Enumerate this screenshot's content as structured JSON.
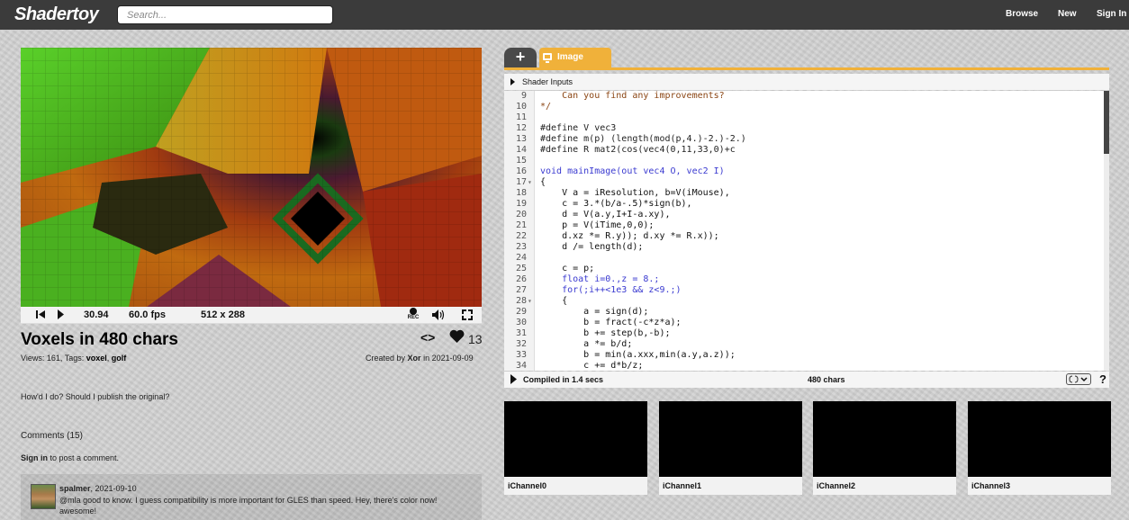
{
  "header": {
    "logo": "Shadertoy",
    "search_placeholder": "Search...",
    "nav": [
      "Browse",
      "New",
      "Sign In"
    ]
  },
  "player": {
    "time": "30.94",
    "fps": "60.0 fps",
    "resolution": "512 x 288",
    "rec_label": "REC"
  },
  "shader": {
    "title": "Voxels in 480 chars",
    "code_icon": "<>",
    "likes": "13",
    "views_label": "Views: 161, Tags:",
    "tag1": "voxel",
    "tag2": "golf",
    "created_prefix": "Created by",
    "author": "Xor",
    "created_date": "in 2021-09-09",
    "description": "How'd I do? Should I publish the original?"
  },
  "comments": {
    "header": "Comments (15)",
    "signin_link": "Sign in",
    "signin_rest": "to post a comment.",
    "items": [
      {
        "user": "spalmer",
        "date": ", 2021-09-10",
        "text": "@mla good to know.  I guess compatibility is more important for GLES than speed.  Hey, there's color now!  awesome!"
      }
    ]
  },
  "editor": {
    "tabs": [
      "+",
      "Image"
    ],
    "shader_inputs": "Shader Inputs",
    "compiled": "Compiled in 1.4 secs",
    "chars": "480 chars",
    "help": "?",
    "lines": [
      {
        "n": "9",
        "fold": "",
        "text": "    Can you find any improvements?",
        "cls": "cm"
      },
      {
        "n": "10",
        "fold": "",
        "text": "*/",
        "cls": "cm"
      },
      {
        "n": "11",
        "fold": "",
        "text": "",
        "cls": "nm"
      },
      {
        "n": "12",
        "fold": "",
        "text": "#define V vec3",
        "cls": "pp"
      },
      {
        "n": "13",
        "fold": "",
        "text": "#define m(p) (length(mod(p,4.)-2.)-2.)",
        "cls": "pp"
      },
      {
        "n": "14",
        "fold": "",
        "text": "#define R mat2(cos(vec4(0,11,33,0)+c",
        "cls": "pp"
      },
      {
        "n": "15",
        "fold": "",
        "text": "",
        "cls": "nm"
      },
      {
        "n": "16",
        "fold": "",
        "text": "void mainImage(out vec4 O, vec2 I)",
        "cls": "kw"
      },
      {
        "n": "17",
        "fold": "▾",
        "text": "{",
        "cls": "nm"
      },
      {
        "n": "18",
        "fold": "",
        "text": "    V a = iResolution, b=V(iMouse),",
        "cls": "nm"
      },
      {
        "n": "19",
        "fold": "",
        "text": "    c = 3.*(b/a-.5)*sign(b),",
        "cls": "nm"
      },
      {
        "n": "20",
        "fold": "",
        "text": "    d = V(a.y,I+I-a.xy),",
        "cls": "nm"
      },
      {
        "n": "21",
        "fold": "",
        "text": "    p = V(iTime,0,0);",
        "cls": "nm"
      },
      {
        "n": "22",
        "fold": "",
        "text": "    d.xz *= R.y)); d.xy *= R.x));",
        "cls": "nm"
      },
      {
        "n": "23",
        "fold": "",
        "text": "    d /= length(d);",
        "cls": "nm"
      },
      {
        "n": "24",
        "fold": "",
        "text": "",
        "cls": "nm"
      },
      {
        "n": "25",
        "fold": "",
        "text": "    c = p;",
        "cls": "nm"
      },
      {
        "n": "26",
        "fold": "",
        "text": "    float i=0.,z = 8.;",
        "cls": "kw"
      },
      {
        "n": "27",
        "fold": "",
        "text": "    for(;i++<1e3 && z<9.;)",
        "cls": "kw"
      },
      {
        "n": "28",
        "fold": "▾",
        "text": "    {",
        "cls": "nm"
      },
      {
        "n": "29",
        "fold": "",
        "text": "        a = sign(d);",
        "cls": "nm"
      },
      {
        "n": "30",
        "fold": "",
        "text": "        b = fract(-c*z*a);",
        "cls": "nm"
      },
      {
        "n": "31",
        "fold": "",
        "text": "        b += step(b,-b);",
        "cls": "nm"
      },
      {
        "n": "32",
        "fold": "",
        "text": "        a *= b/d;",
        "cls": "nm"
      },
      {
        "n": "33",
        "fold": "",
        "text": "        b = min(a.xxx,min(a.y,a.z));",
        "cls": "nm"
      },
      {
        "n": "34",
        "fold": "",
        "text": "        c += d*b/z;",
        "cls": "nm"
      }
    ]
  },
  "channels": [
    "iChannel0",
    "iChannel1",
    "iChannel2",
    "iChannel3"
  ]
}
